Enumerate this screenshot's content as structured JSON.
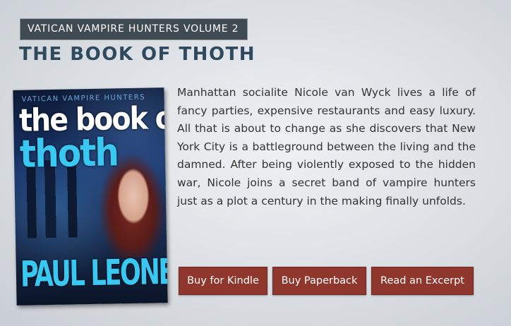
{
  "series": {
    "label": "VATICAN VAMPIRE HUNTERS VOLUME 2"
  },
  "book": {
    "title": "THE BOOK OF THOTH",
    "description": "Manhattan socialite Nicole van Wyck lives a life of fancy parties, expensive restaurants and easy luxury. All that is about to change as she discovers that New York City is a battleground between the living and the damned. After being violently exposed to the hidden war, Nicole joins a secret band of vampire hunters just as a plot a century in the making finally unfolds."
  },
  "cover": {
    "series_tag": "VATICAN VAMPIRE HUNTERS",
    "title_line_1": "the book of",
    "title_line_2": "thoth",
    "author": "PAUL LEONE",
    "title_color": "#38c8f2"
  },
  "actions": {
    "kindle_label": "Buy for Kindle",
    "paperback_label": "Buy Paperback",
    "excerpt_label": "Read an Excerpt",
    "button_color": "#8f372c"
  }
}
